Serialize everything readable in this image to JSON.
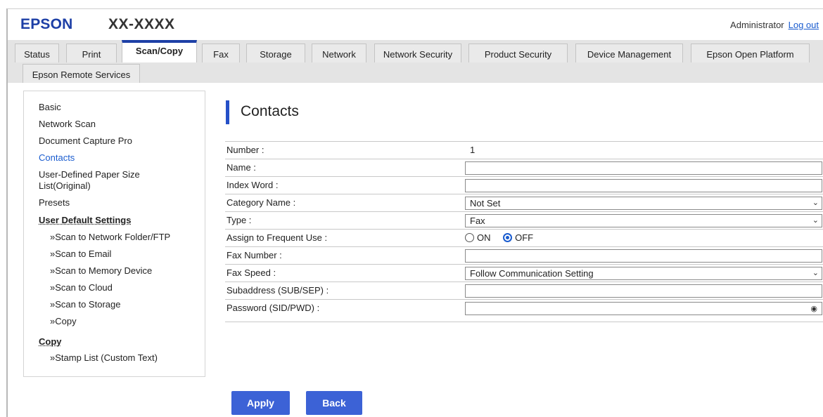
{
  "header": {
    "brand": "EPSON",
    "model": "XX-XXXX",
    "user": "Administrator",
    "logout": "Log out"
  },
  "tabs": [
    {
      "label": "Status"
    },
    {
      "label": "Print"
    },
    {
      "label": "Scan/Copy",
      "active": true
    },
    {
      "label": "Fax"
    },
    {
      "label": "Storage"
    },
    {
      "label": "Network"
    },
    {
      "label": "Network Security"
    },
    {
      "label": "Product Security"
    },
    {
      "label": "Device Management"
    },
    {
      "label": "Epson Open Platform"
    },
    {
      "label": "Epson Remote Services"
    }
  ],
  "sidebar": {
    "items": [
      {
        "label": "Basic"
      },
      {
        "label": "Network Scan"
      },
      {
        "label": "Document Capture Pro"
      },
      {
        "label": "Contacts",
        "current": true
      },
      {
        "label": "User-Defined Paper Size"
      },
      {
        "label": "List(Original)"
      },
      {
        "label": "Presets"
      },
      {
        "label": "User Default Settings"
      },
      {
        "label": "»Scan to Network Folder/FTP"
      },
      {
        "label": "»Scan to Email"
      },
      {
        "label": "»Scan to Memory Device"
      },
      {
        "label": "»Scan to Cloud"
      },
      {
        "label": "»Scan to Storage"
      },
      {
        "label": "»Copy"
      },
      {
        "label": "Copy"
      },
      {
        "label": "»Stamp List (Custom Text)"
      }
    ]
  },
  "main": {
    "title": "Contacts",
    "rows": {
      "number": {
        "label": "Number :",
        "value": "1"
      },
      "name": {
        "label": "Name :",
        "value": ""
      },
      "index_word": {
        "label": "Index Word :",
        "value": ""
      },
      "category": {
        "label": "Category Name :",
        "value": "Not Set"
      },
      "type": {
        "label": "Type :",
        "value": "Fax"
      },
      "frequent": {
        "label": "Assign to Frequent Use :",
        "on": "ON",
        "off": "OFF",
        "selected": "OFF"
      },
      "fax_number": {
        "label": "Fax Number :",
        "value": ""
      },
      "fax_speed": {
        "label": "Fax Speed :",
        "value": "Follow Communication Setting"
      },
      "subaddress": {
        "label": "Subaddress (SUB/SEP) :",
        "value": ""
      },
      "password": {
        "label": "Password (SID/PWD) :",
        "value": ""
      }
    },
    "apply": "Apply",
    "back": "Back"
  },
  "colors": {
    "brand": "#1d3fa6",
    "accent": "#2550c8",
    "link": "#1a5ccf",
    "button": "#3c62d6"
  }
}
